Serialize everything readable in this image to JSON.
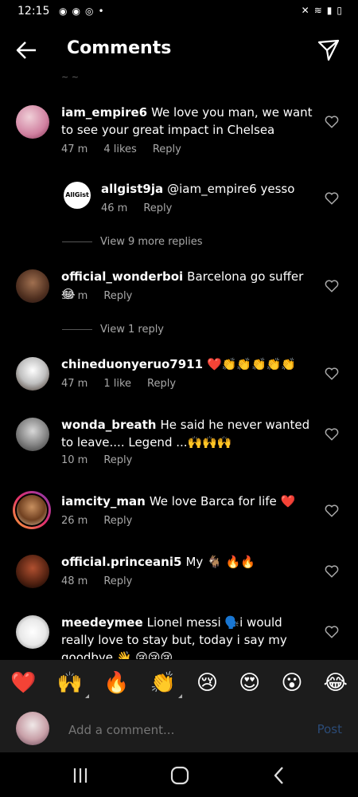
{
  "status": {
    "time": "12:15",
    "icons_left": [
      "chat-icon",
      "messenger-icon",
      "instagram-icon",
      "dot-icon"
    ],
    "icons_right": [
      "mute-icon",
      "wifi-icon",
      "signal-icon",
      "battery-icon"
    ]
  },
  "header": {
    "title": "Comments"
  },
  "comments": [
    {
      "user": "iam_empire6",
      "text": "We love you man, we want to see your great impact in Chelsea",
      "time": "47 m",
      "likes": "4 likes",
      "reply": "Reply"
    },
    {
      "user": "allgist9ja",
      "text": "@iam_empire6 yesso",
      "time": "46 m",
      "reply": "Reply",
      "avatar_text": "AllGist"
    },
    {
      "view_replies": "View 9 more replies"
    },
    {
      "user": "official_wonderboi",
      "text": "Barcelona go suffer 😂",
      "time": "35 m",
      "reply": "Reply"
    },
    {
      "view_replies": "View 1 reply"
    },
    {
      "user": "chineduonyeruo7911",
      "text": "❤️👏👏👏👏👏",
      "time": "47 m",
      "likes": "1 like",
      "reply": "Reply"
    },
    {
      "user": "wonda_breath",
      "text": "He said he never wanted to leave.... Legend ...🙌🙌🙌",
      "time": "10 m",
      "reply": "Reply"
    },
    {
      "user": "iamcity_man",
      "text": "We love Barca for life ❤️",
      "time": "26 m",
      "reply": "Reply"
    },
    {
      "user": "official.princeani5",
      "text": "My 🐐 🔥🔥",
      "time": "48 m",
      "reply": "Reply"
    },
    {
      "user": "meedeymee",
      "text": "Lionel messi 🗣️i would really love to stay but, today i say my goodbye 👋 😢😢😢"
    }
  ],
  "emoji_bar": [
    "❤️",
    "🙌",
    "🔥",
    "👏",
    "😢",
    "😍",
    "😮",
    "😂"
  ],
  "add_comment": {
    "placeholder": "Add a comment...",
    "post": "Post"
  }
}
